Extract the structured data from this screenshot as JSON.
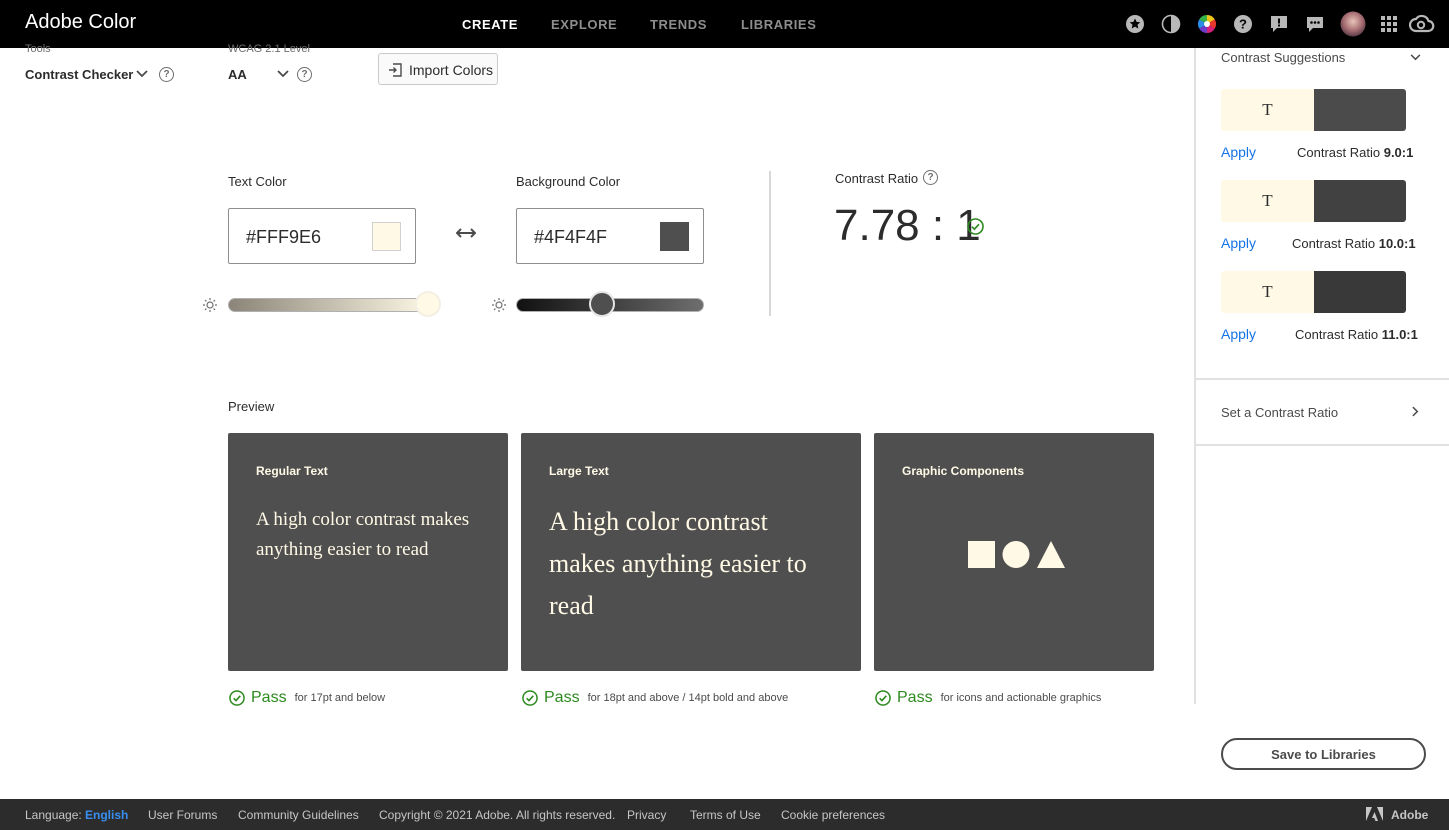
{
  "app": {
    "title": "Adobe Color"
  },
  "nav": {
    "items": [
      "CREATE",
      "EXPLORE",
      "TRENDS",
      "LIBRARIES"
    ],
    "active": "CREATE"
  },
  "header_icons": [
    "star-icon",
    "dark-mode-icon",
    "color-wheel-icon",
    "help-icon",
    "feedback-icon",
    "chat-icon",
    "avatar",
    "apps-grid-icon",
    "creative-cloud-icon"
  ],
  "tools": {
    "tools_label": "Tools",
    "tool_value": "Contrast Checker",
    "wcag_label": "WCAG 2.1 Level",
    "wcag_value": "AA",
    "import_label": "Import Colors"
  },
  "checker": {
    "text_color_label": "Text Color",
    "text_color_value": "#FFF9E6",
    "bg_color_label": "Background Color",
    "bg_color_value": "#4F4F4F",
    "text_brightness": 0.97,
    "bg_brightness": 0.46,
    "contrast_label": "Contrast Ratio",
    "contrast_value": "7.78 : 1"
  },
  "preview": {
    "label": "Preview",
    "cards": [
      {
        "title": "Regular Text",
        "body": "A high color contrast makes anything easier to read",
        "pass": "Pass",
        "desc": "for 17pt and below"
      },
      {
        "title": "Large Text",
        "body": "A high color contrast makes anything easier to read",
        "pass": "Pass",
        "desc": "for 18pt and above / 14pt bold and above"
      },
      {
        "title": "Graphic Components",
        "body": "",
        "pass": "Pass",
        "desc": "for icons and actionable graphics"
      }
    ]
  },
  "panel": {
    "suggestions_title": "Contrast Suggestions",
    "swatch_letter": "T",
    "apply_label": "Apply",
    "ratio_prefix": "Contrast Ratio",
    "suggestions": [
      {
        "ratio": "9.0:1",
        "bg": "#4b4b4b"
      },
      {
        "ratio": "10.0:1",
        "bg": "#414141"
      },
      {
        "ratio": "11.0:1",
        "bg": "#393939"
      }
    ],
    "set_ratio_label": "Set a Contrast Ratio",
    "save_label": "Save to Libraries"
  },
  "footer": {
    "language_label": "Language:",
    "language_value": "English",
    "forums": "User Forums",
    "guidelines": "Community Guidelines",
    "copyright": "Copyright © 2021 Adobe. All rights reserved.",
    "privacy": "Privacy",
    "terms": "Terms of Use",
    "cookies": "Cookie preferences",
    "adobe": "Adobe"
  },
  "colors": {
    "text": "#FFF9E6",
    "background": "#4F4F4F",
    "pass": "#2d8a1f",
    "link": "#1473e6"
  }
}
